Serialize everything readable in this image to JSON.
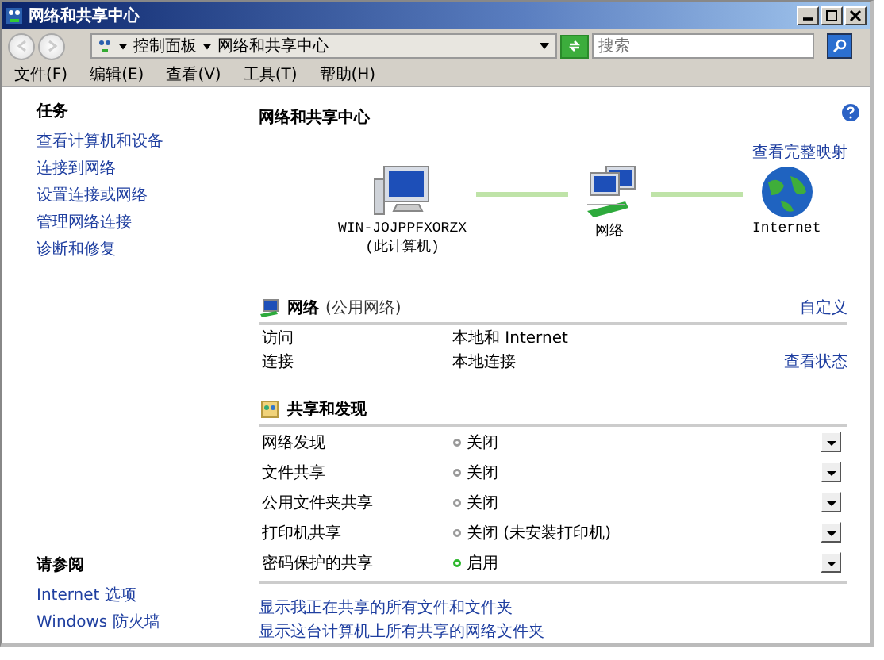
{
  "window": {
    "title": "网络和共享中心"
  },
  "address": {
    "crumbs": [
      "控制面板",
      "网络和共享中心"
    ]
  },
  "search": {
    "placeholder": "搜索"
  },
  "menu": [
    "文件(F)",
    "编辑(E)",
    "查看(V)",
    "工具(T)",
    "帮助(H)"
  ],
  "sidebar": {
    "tasks_title": "任务",
    "tasks": [
      "查看计算机和设备",
      "连接到网络",
      "设置连接或网络",
      "管理网络连接",
      "诊断和修复"
    ],
    "see_also_title": "请参阅",
    "see_also": [
      "Internet 选项",
      "Windows 防火墙"
    ]
  },
  "main": {
    "title": "网络和共享中心",
    "full_map_link": "查看完整映射",
    "map": [
      {
        "kind": "computer",
        "label": "WIN-JOJPPFXORZX",
        "sublabel": "(此计算机)"
      },
      {
        "kind": "network",
        "label": "网络"
      },
      {
        "kind": "internet",
        "label": "Internet"
      }
    ],
    "network": {
      "name": "网络",
      "type": "(公用网络)",
      "customize_link": "自定义",
      "rows": [
        {
          "label": "访问",
          "value": "本地和 Internet"
        },
        {
          "label": "连接",
          "value": "本地连接",
          "link": "查看状态"
        }
      ]
    },
    "sharing": {
      "title": "共享和发现",
      "rows": [
        {
          "label": "网络发现",
          "value": "关闭",
          "on": false
        },
        {
          "label": "文件共享",
          "value": "关闭",
          "on": false
        },
        {
          "label": "公用文件夹共享",
          "value": "关闭",
          "on": false
        },
        {
          "label": "打印机共享",
          "value": "关闭 (未安装打印机)",
          "on": false
        },
        {
          "label": "密码保护的共享",
          "value": "启用",
          "on": true
        }
      ]
    },
    "links": [
      "显示我正在共享的所有文件和文件夹",
      "显示这台计算机上所有共享的网络文件夹"
    ]
  }
}
